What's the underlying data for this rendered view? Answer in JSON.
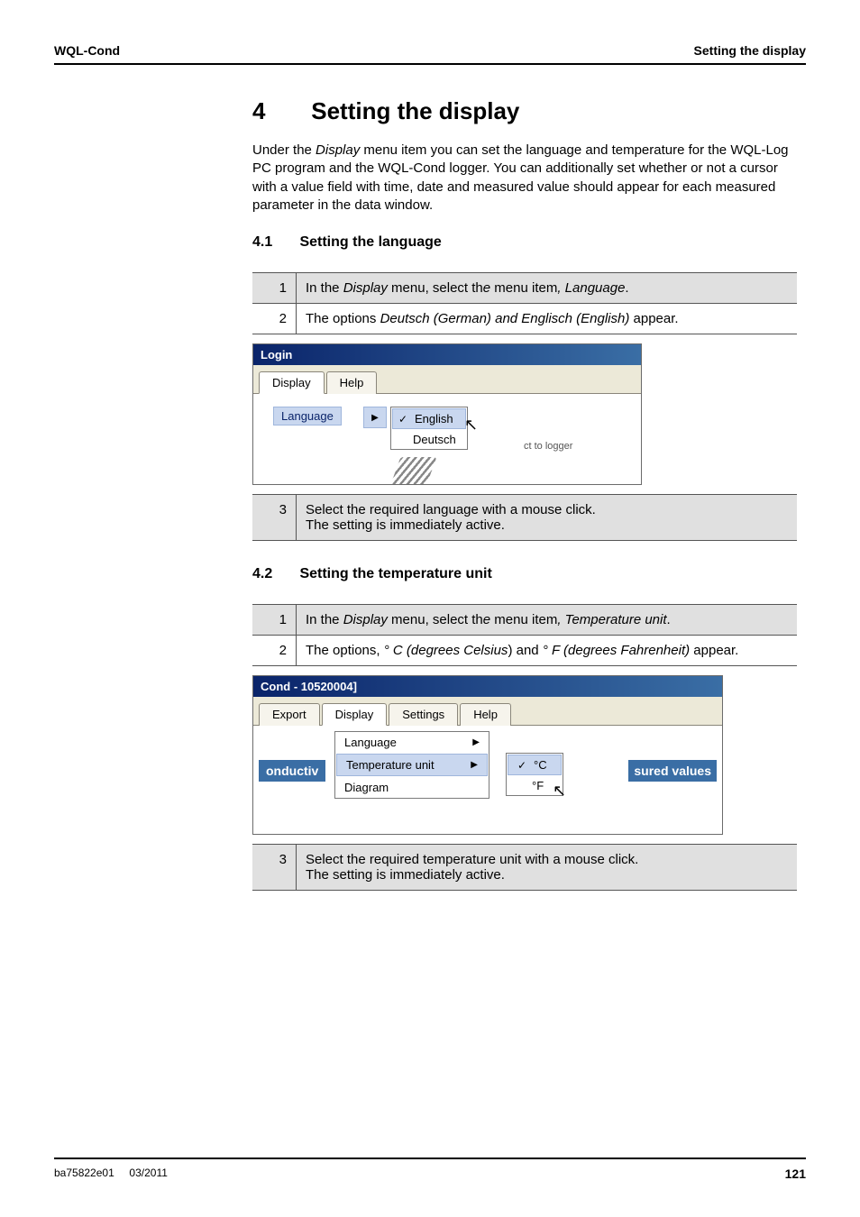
{
  "header": {
    "left": "WQL-Cond",
    "right": "Setting the display"
  },
  "section4": {
    "num": "4",
    "title": "Setting the display",
    "intro": "Under the Display menu item you can set the language and temperature for the WQL-Log PC program and the WQL-Cond logger. You can additionally set whether or not a cursor with a value field with time, date and measured value should appear for each measured parameter in the data window.",
    "intro_italic_word": "Display"
  },
  "section41": {
    "num": "4.1",
    "title": "Setting the language",
    "step1": {
      "num": "1",
      "pre": "In the ",
      "it1": "Display",
      "mid": " menu, select th",
      "e": "e",
      "mid2": " menu item",
      "comma": ", ",
      "it2": "Language",
      "post": "."
    },
    "step2": {
      "num": "2",
      "pre": "The options ",
      "it": "Deutsch (German) and Englisch (English)",
      "post": " appear."
    },
    "step3": {
      "num": "3",
      "line1": "Select the required language with a mouse click.",
      "line2": "The setting is immediately active."
    }
  },
  "login_win": {
    "title": "Login",
    "tab_display": "Display",
    "tab_help": "Help",
    "language_label": "Language",
    "opt_english": "English",
    "opt_deutsch": "Deutsch",
    "connect": "ct to logger"
  },
  "section42": {
    "num": "4.2",
    "title": "Setting the temperature unit",
    "step1": {
      "num": "1",
      "pre": "In the ",
      "it1": "Display",
      "mid": " menu, select th",
      "e": "e",
      "mid2": " menu item",
      "comma": ", ",
      "it2": "Temperature unit",
      "post": "."
    },
    "step2": {
      "num": "2",
      "pre": "The options, ",
      "it1": "° C (degrees Celsius",
      "paren": ")",
      "mid": " and ",
      "it2": "° F (degrees Fahrenheit)",
      "post": " appear."
    },
    "step3": {
      "num": "3",
      "line1": "Select the required temperature unit with a mouse click.",
      "line2": "The setting is immediately active."
    }
  },
  "cond_win": {
    "title": "Cond - 10520004]",
    "tab_export": "Export",
    "tab_display": "Display",
    "tab_settings": "Settings",
    "tab_help": "Help",
    "menu_language": "Language",
    "menu_temp": "Temperature unit",
    "menu_diagram": "Diagram",
    "unit_c": "°C",
    "unit_f": "°F",
    "left_frag": "onductiv",
    "right_frag": "sured values"
  },
  "footer": {
    "doc": "ba75822e01",
    "date": "03/2011",
    "page": "121"
  }
}
